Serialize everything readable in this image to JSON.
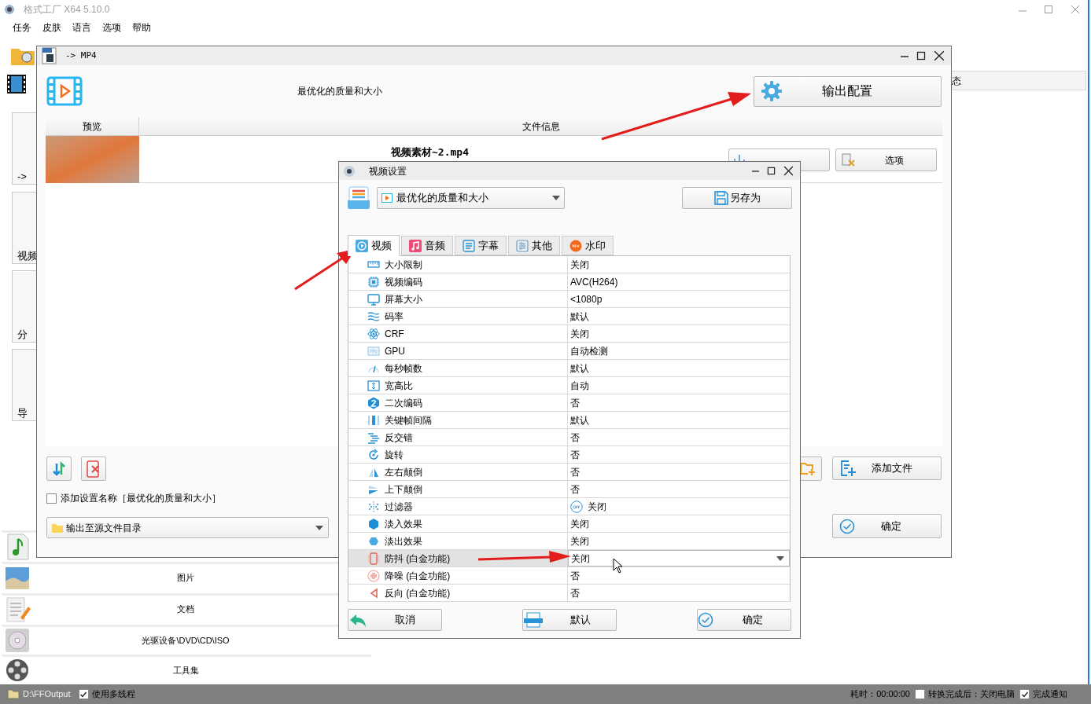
{
  "app": {
    "title": "格式工厂 X64 5.10.0",
    "menu": [
      "任务",
      "皮肤",
      "语言",
      "选项",
      "帮助"
    ],
    "sidebar_partial": [
      "->",
      "视频",
      "分",
      "导"
    ],
    "categories": [
      {
        "kind": "audio"
      },
      {
        "kind": "image",
        "label": "图片"
      },
      {
        "kind": "document",
        "label": "文档"
      },
      {
        "kind": "disc",
        "label": "光驱设备\\DVD\\CD\\ISO"
      },
      {
        "kind": "tools",
        "label": "工具集"
      }
    ],
    "status_column": "态",
    "status_bar": {
      "path": "D:\\FFOutput",
      "multithread": {
        "label": "使用多线程",
        "checked": true
      },
      "elapsed": "耗时：00:00:00",
      "shutdown": {
        "label": "转换完成后：关闭电脑",
        "checked": false
      },
      "notify": {
        "label": "完成通知",
        "checked": true
      }
    }
  },
  "mp4_window": {
    "title": "-> MP4",
    "preset": "最优化的质量和大小",
    "output_config_button": "输出配置",
    "columns": [
      "预览",
      "文件信息"
    ],
    "file": {
      "name": "视频素材~2.mp4",
      "buttons": [
        "选项"
      ]
    },
    "add_name_checkbox": {
      "label": "添加设置名称［最优化的质量和大小］",
      "checked": false
    },
    "output_dir": "输出至源文件目录",
    "add_file_button": "添加文件",
    "ok_button": "确定"
  },
  "dialog": {
    "title": "视频设置",
    "preset": "最优化的质量和大小",
    "save_as_button": "另存为",
    "tabs": [
      {
        "label": "视频",
        "kind": "video",
        "selected": true
      },
      {
        "label": "音频",
        "kind": "audio",
        "selected": false
      },
      {
        "label": "字幕",
        "kind": "subtitle",
        "selected": false
      },
      {
        "label": "其他",
        "kind": "other",
        "selected": false
      },
      {
        "label": "水印",
        "kind": "watermark",
        "selected": false
      }
    ],
    "rows": [
      {
        "name": "大小限制",
        "value": "关闭",
        "kind": "text",
        "selected": false
      },
      {
        "name": "视频编码",
        "value": "AVC(H264)",
        "kind": "text",
        "selected": false
      },
      {
        "name": "屏幕大小",
        "value": "<1080p",
        "kind": "text",
        "selected": false
      },
      {
        "name": "码率",
        "value": "默认",
        "kind": "text",
        "selected": false
      },
      {
        "name": "CRF",
        "value": "关闭",
        "kind": "text",
        "selected": false
      },
      {
        "name": "GPU",
        "value": "自动检测",
        "kind": "text",
        "selected": false
      },
      {
        "name": "每秒帧数",
        "value": "默认",
        "kind": "text",
        "selected": false
      },
      {
        "name": "宽高比",
        "value": "自动",
        "kind": "text",
        "selected": false
      },
      {
        "name": "二次编码",
        "value": "否",
        "kind": "text",
        "selected": false
      },
      {
        "name": "关键帧间隔",
        "value": "默认",
        "kind": "text",
        "selected": false
      },
      {
        "name": "反交错",
        "value": "否",
        "kind": "text",
        "selected": false
      },
      {
        "name": "旋转",
        "value": "否",
        "kind": "text",
        "selected": false
      },
      {
        "name": "左右颠倒",
        "value": "否",
        "kind": "text",
        "selected": false
      },
      {
        "name": "上下颠倒",
        "value": "否",
        "kind": "text",
        "selected": false
      },
      {
        "name": "过滤器",
        "value": "关闭",
        "kind": "toggle",
        "selected": false
      },
      {
        "name": "淡入效果",
        "value": "关闭",
        "kind": "text",
        "selected": false
      },
      {
        "name": "淡出效果",
        "value": "关闭",
        "kind": "text",
        "selected": false
      },
      {
        "name": "防抖 (白金功能)",
        "value": "关闭",
        "kind": "dropdown",
        "selected": true
      },
      {
        "name": "降噪 (白金功能)",
        "value": "否",
        "kind": "text",
        "selected": false
      },
      {
        "name": "反向 (白金功能)",
        "value": "否",
        "kind": "text",
        "selected": false
      }
    ],
    "buttons": [
      {
        "label": "取消",
        "kind": "cancel"
      },
      {
        "label": "默认",
        "kind": "default"
      },
      {
        "label": "确定",
        "kind": "ok"
      }
    ]
  }
}
